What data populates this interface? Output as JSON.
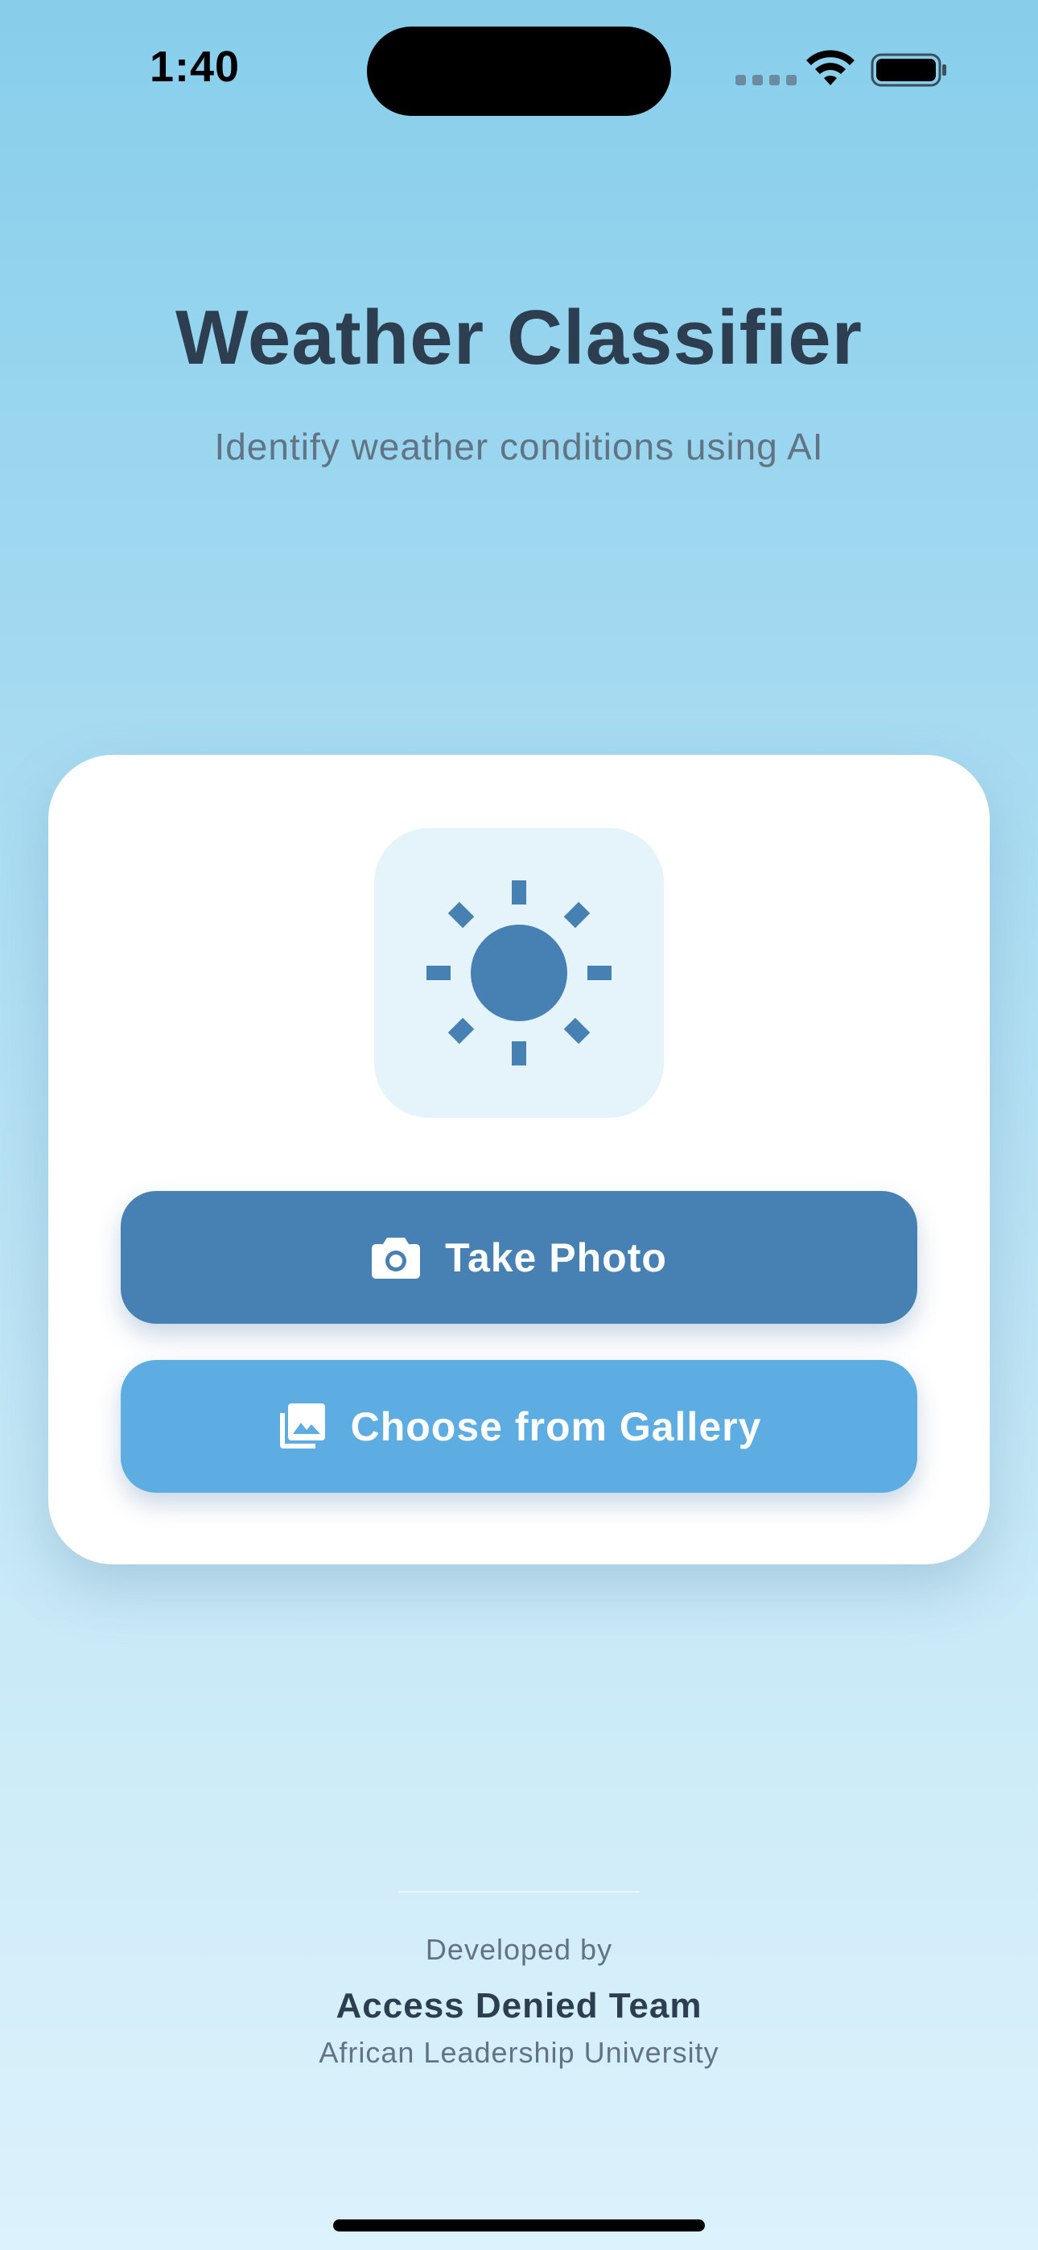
{
  "status_bar": {
    "time": "1:40",
    "icons": [
      "cellular-icon",
      "wifi-icon",
      "battery-icon"
    ]
  },
  "header": {
    "title": "Weather Classifier",
    "subtitle": "Identify weather conditions using AI"
  },
  "card": {
    "icon": "sun-icon",
    "take_photo": {
      "label": "Take Photo",
      "icon": "camera-icon"
    },
    "choose_gallery": {
      "label": "Choose from Gallery",
      "icon": "gallery-icon"
    }
  },
  "footer": {
    "developed_by": "Developed by",
    "team": "Access Denied Team",
    "university": "African Leadership University"
  },
  "colors": {
    "title": "#2c3e50",
    "primary_button": "#4781b4",
    "secondary_button": "#5dade2",
    "sun": "#4781b4",
    "sun_tile": "#e5f3fa",
    "background_top": "#87ceeb",
    "background_bottom": "#dcf2fc"
  }
}
